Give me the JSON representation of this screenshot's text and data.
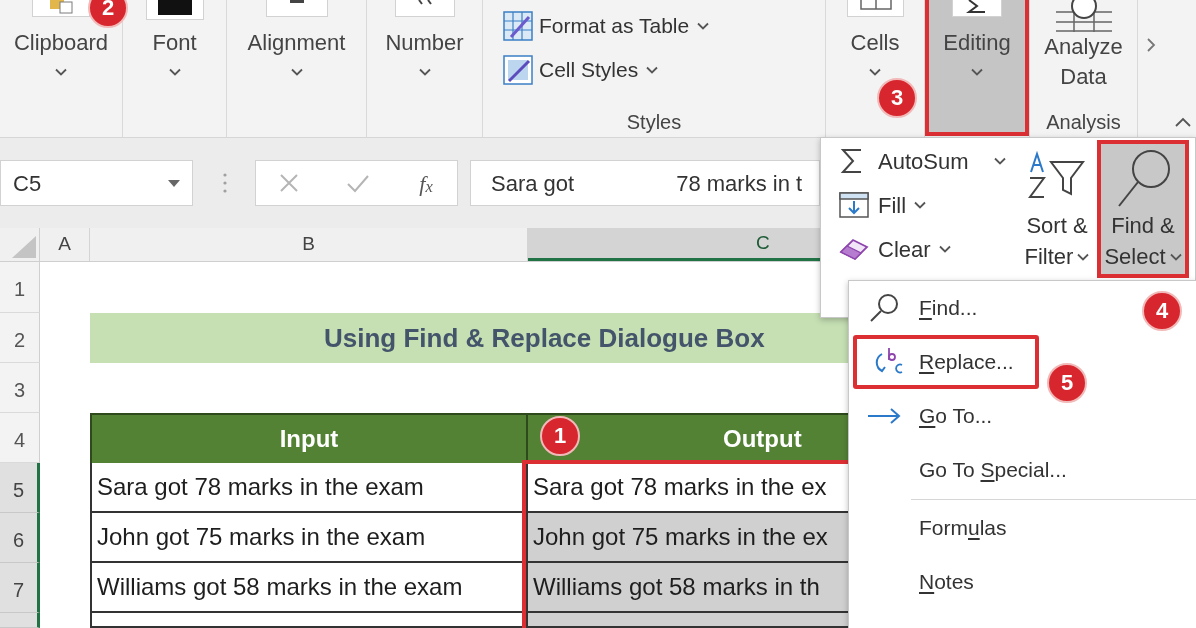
{
  "ribbon": {
    "groups": [
      {
        "kind": "collapsed",
        "label": "Clipboard",
        "selected": false,
        "highlighted": false,
        "badge": "2"
      },
      {
        "kind": "collapsed",
        "label": "Font",
        "selected": false,
        "highlighted": false
      },
      {
        "kind": "collapsed",
        "label": "Alignment",
        "selected": false,
        "highlighted": false
      },
      {
        "kind": "collapsed",
        "label": "Number",
        "selected": false,
        "highlighted": false
      },
      {
        "kind": "commands",
        "label": "Styles",
        "commands": [
          "Format as Table",
          "Cell Styles"
        ]
      },
      {
        "kind": "collapsed",
        "label": "Cells",
        "selected": false,
        "highlighted": false
      },
      {
        "kind": "collapsed",
        "label": "Editing",
        "selected": true,
        "highlighted": true,
        "badge": "3"
      },
      {
        "kind": "large_button",
        "label": "Analysis",
        "button_lines": [
          "Analyze",
          "Data"
        ]
      }
    ]
  },
  "formula_bar": {
    "name_box": "C5",
    "insert_function": "f$_{x}$",
    "formula_parts": [
      "Sara got",
      "78 marks in t"
    ]
  },
  "sheet": {
    "columns": [
      {
        "label": "A",
        "selected": false
      },
      {
        "label": "B",
        "selected": false
      },
      {
        "label": "C",
        "selected": true
      }
    ],
    "rows": [
      {
        "label": "1",
        "selected": false
      },
      {
        "label": "2",
        "selected": false
      },
      {
        "label": "3",
        "selected": false
      },
      {
        "label": "4",
        "selected": false
      },
      {
        "label": "5",
        "selected": true
      },
      {
        "label": "6",
        "selected": true
      },
      {
        "label": "7",
        "selected": true
      },
      {
        "selected": true
      }
    ],
    "title": "Using Find & Replace Dialogue Box",
    "table": {
      "columns": [
        {
          "label": "Input",
          "highlighted": false
        },
        {
          "label": "Output",
          "highlighted": true,
          "badge": "1"
        }
      ],
      "rows": [
        {
          "cells": [
            {
              "text": "Sara got 78 marks in the exam",
              "selected": false
            },
            {
              "text": "Sara got 78 marks in the ex",
              "selected": false
            }
          ]
        },
        {
          "cells": [
            {
              "text": "John got 75 marks in the exam",
              "selected": false
            },
            {
              "text": "John got 75 marks in the ex",
              "selected": true
            }
          ]
        },
        {
          "cells": [
            {
              "text": "Williams got 58 marks in the exam",
              "selected": false
            },
            {
              "text": "Williams got 58 marks in th",
              "selected": true
            }
          ]
        },
        {
          "cells": [
            {
              "selected": false
            },
            {
              "selected": true
            }
          ]
        }
      ]
    }
  },
  "editing_menu": {
    "commands": [
      {
        "label": "AutoSum",
        "kind": "split"
      },
      {
        "label": "Fill",
        "kind": "dropdown"
      },
      {
        "label": "Clear",
        "kind": "dropdown"
      }
    ],
    "buttons": [
      {
        "lines": [
          "Sort &",
          "Filter"
        ],
        "selected": false,
        "highlighted": false
      },
      {
        "lines": [
          "Find &",
          "Select"
        ],
        "selected": true,
        "highlighted": true,
        "badge": "4"
      }
    ]
  },
  "find_menu": {
    "items": [
      {
        "kind": "command",
        "key": "F",
        "after": "ind...",
        "highlighted": false
      },
      {
        "kind": "command",
        "key": "R",
        "after": "eplace...",
        "highlighted": true,
        "badge": "5"
      },
      {
        "kind": "command",
        "key": "G",
        "after": "o To...",
        "highlighted": false
      },
      {
        "kind": "command",
        "before": "Go To ",
        "key": "S",
        "after": "pecial...",
        "highlighted": false
      },
      {
        "kind": "separator"
      },
      {
        "kind": "command",
        "before": "Form",
        "key": "u",
        "after": "las",
        "highlighted": false
      },
      {
        "kind": "command",
        "key": "N",
        "after": "otes",
        "highlighted": false
      }
    ]
  }
}
